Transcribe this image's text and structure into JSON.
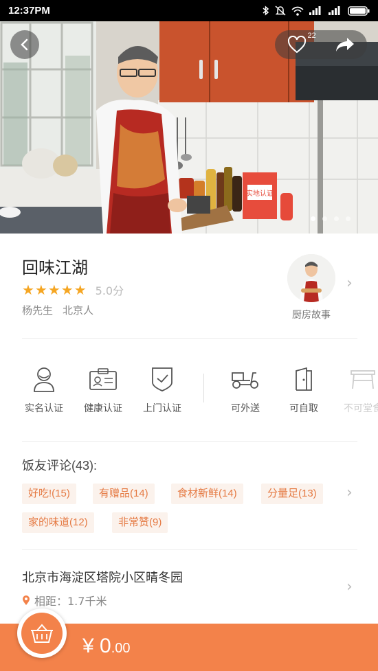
{
  "status_bar": {
    "time": "12:37PM"
  },
  "hero": {
    "like_count": "22",
    "carousel_pages": 4,
    "active_page": 1,
    "overlay_text": "实地认证"
  },
  "shop": {
    "name": "回味江湖",
    "rating_stars": 5,
    "score": "5.0分",
    "owner": "杨先生",
    "origin": "北京人",
    "kitchen_story_label": "厨房故事"
  },
  "badges": [
    {
      "label": "实名认证",
      "icon": "person-icon"
    },
    {
      "label": "健康认证",
      "icon": "id-card-icon"
    },
    {
      "label": "上门认证",
      "icon": "shield-check-icon"
    },
    {
      "label": "可外送",
      "icon": "scooter-icon"
    },
    {
      "label": "可自取",
      "icon": "door-icon"
    },
    {
      "label": "不可堂食",
      "icon": "table-icon"
    }
  ],
  "reviews": {
    "title": "饭友评论(43):",
    "tags": [
      "好吃!(15)",
      "有赠品(14)",
      "食材新鲜(14)",
      "分量足(13)",
      "家的味道(12)",
      "非常赞(9)"
    ]
  },
  "address": {
    "text": "北京市海淀区塔院小区晴冬园",
    "distance": "相距：1.7千米"
  },
  "cart": {
    "price_main": "¥ 0",
    "price_decimal": ".00"
  },
  "colors": {
    "accent": "#f3824a",
    "star": "#f5a623",
    "tag_bg": "#fbf2ec",
    "tag_text": "#e57a43"
  }
}
